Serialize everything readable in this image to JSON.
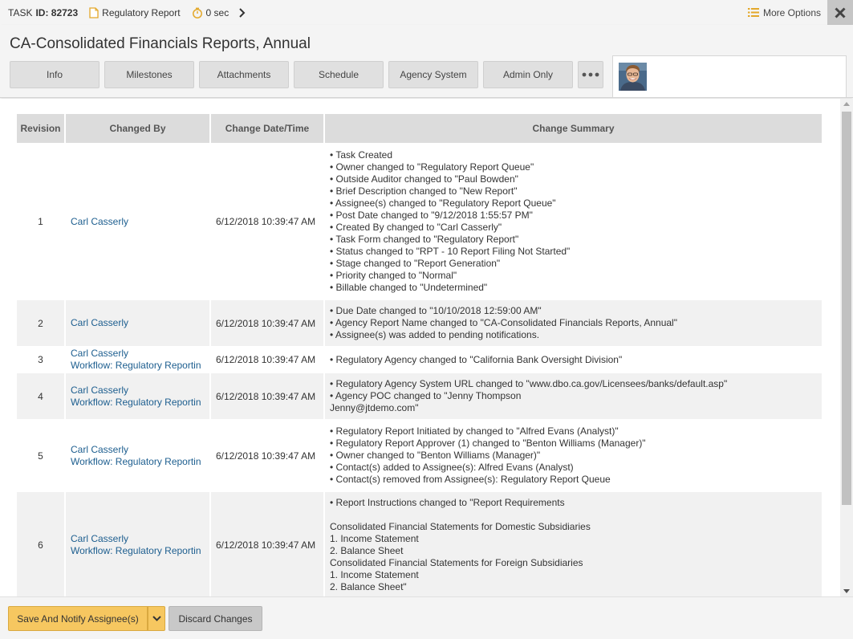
{
  "topbar": {
    "task_label": "TASK",
    "task_id": "ID: 82723",
    "report_type": "Regulatory Report",
    "timer": "0 sec",
    "more_options": "More Options"
  },
  "header": {
    "title": "CA-Consolidated Financials Reports, Annual",
    "tabs": [
      "Info",
      "Milestones",
      "Attachments",
      "Schedule",
      "Agency System",
      "Admin Only"
    ]
  },
  "table": {
    "columns": [
      "Revision",
      "Changed By",
      "Change Date/Time",
      "Change Summary"
    ],
    "rows": [
      {
        "revision": "1",
        "changed_by": [
          "Carl Casserly"
        ],
        "date": "6/12/2018 10:39:47 AM",
        "summary": [
          "• Task Created",
          "• Owner changed to \"Regulatory Report Queue\"",
          "• Outside Auditor changed to \"Paul Bowden\"",
          "• Brief Description changed to \"New Report\"",
          "• Assignee(s) changed to \"Regulatory Report Queue\"",
          "• Post Date changed to \"9/12/2018 1:55:57 PM\"",
          "• Created By changed to \"Carl Casserly\"",
          "• Task Form changed to \"Regulatory Report\"",
          "• Status changed to \"RPT - 10 Report Filing Not Started\"",
          "• Stage changed to \"Report Generation\"",
          "• Priority changed to \"Normal\"",
          "• Billable changed to \"Undetermined\""
        ]
      },
      {
        "revision": "2",
        "changed_by": [
          "Carl Casserly"
        ],
        "date": "6/12/2018 10:39:47 AM",
        "summary": [
          "• Due Date changed to \"10/10/2018 12:59:00 AM\"",
          "• Agency Report Name changed to \"CA-Consolidated Financials Reports, Annual\"",
          "• Assignee(s) was added to pending notifications."
        ]
      },
      {
        "revision": "3",
        "changed_by": [
          "Carl Casserly",
          "Workflow: Regulatory Reportin"
        ],
        "date": "6/12/2018 10:39:47 AM",
        "summary": [
          "• Regulatory Agency changed to \"California Bank Oversight Division\""
        ]
      },
      {
        "revision": "4",
        "changed_by": [
          "Carl Casserly",
          "Workflow: Regulatory Reportin"
        ],
        "date": "6/12/2018 10:39:47 AM",
        "summary": [
          "• Regulatory Agency System URL changed to \"www.dbo.ca.gov/Licensees/banks/default.asp\"",
          "• Agency POC changed to \"Jenny Thompson",
          "Jenny@jtdemo.com\""
        ]
      },
      {
        "revision": "5",
        "changed_by": [
          "Carl Casserly",
          "Workflow: Regulatory Reportin"
        ],
        "date": "6/12/2018 10:39:47 AM",
        "summary": [
          "• Regulatory Report Initiated by changed to \"Alfred Evans (Analyst)\"",
          "• Regulatory Report Approver (1) changed to \"Benton Williams (Manager)\"",
          "• Owner changed to \"Benton Williams (Manager)\"",
          "• Contact(s) added to Assignee(s): Alfred Evans (Analyst)",
          "• Contact(s) removed from Assignee(s): Regulatory Report Queue"
        ]
      },
      {
        "revision": "6",
        "changed_by": [
          "Carl Casserly",
          "Workflow: Regulatory Reportin"
        ],
        "date": "6/12/2018 10:39:47 AM",
        "summary": [
          "• Report Instructions changed to \"Report Requirements",
          "",
          "Consolidated Financial Statements for Domestic Subsidiaries",
          "1. Income Statement",
          "2. Balance Sheet",
          "Consolidated Financial Statements for Foreign Subsidiaries",
          "1. Income Statement",
          "2. Balance Sheet\""
        ]
      }
    ]
  },
  "footer": {
    "save_label": "Save And Notify Assignee(s)",
    "discard_label": "Discard Changes"
  },
  "colors": {
    "accent": "#f6c760",
    "link": "#1d5e8f",
    "header_bg": "#dcdcdc",
    "alt_row": "#f1f1f1"
  },
  "icons": [
    "document-icon",
    "stopwatch-icon",
    "chevron-right-icon",
    "list-icon",
    "close-icon",
    "more-dots-icon",
    "chevron-down-icon"
  ]
}
